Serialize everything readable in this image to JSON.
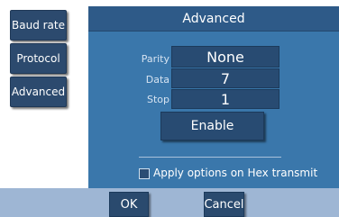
{
  "sidebar": {
    "items": [
      {
        "label": "Baud rate"
      },
      {
        "label": "Protocol"
      },
      {
        "label": "Advanced"
      }
    ]
  },
  "panel": {
    "title": "Advanced",
    "fields": [
      {
        "label": "Parity",
        "value": "None"
      },
      {
        "label": "Data",
        "value": "7"
      },
      {
        "label": "Stop",
        "value": "1"
      }
    ],
    "enable_label": "Enable",
    "hex_option_label": "Apply options on Hex transmit",
    "hex_option_checked": false
  },
  "footer": {
    "ok_label": "OK",
    "cancel_label": "Cancel"
  },
  "colors": {
    "panel_bg": "#3a77ab",
    "button_bg": "#2c4a6e",
    "footer_bg": "#9eb6d4"
  }
}
